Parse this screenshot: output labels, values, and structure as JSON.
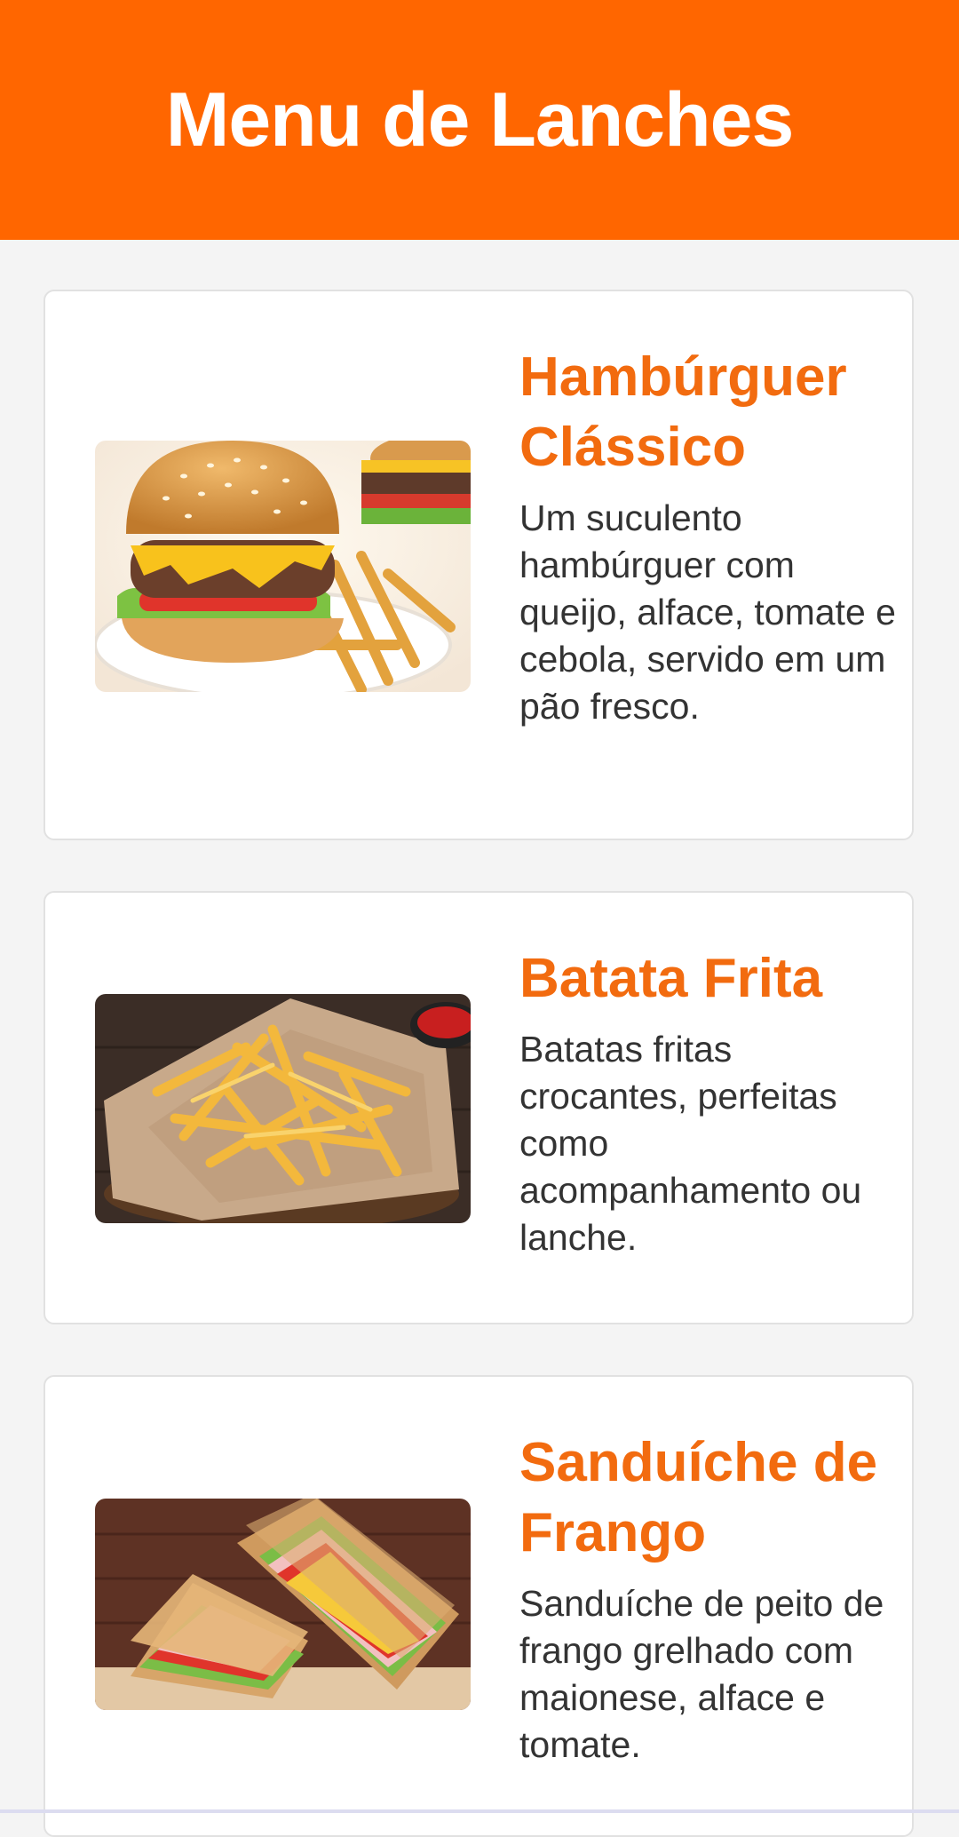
{
  "header": {
    "title": "Menu de Lanches"
  },
  "menu": [
    {
      "title": "Hambúrguer Clássico",
      "description": "Um suculento hambúrguer com queijo, alface, tomate e cebola, servido em um pão fresco.",
      "image_icon": "burger-photo"
    },
    {
      "title": "Batata Frita",
      "description": "Batatas fritas crocantes, perfeitas como acompanhamento ou lanche.",
      "image_icon": "fries-photo"
    },
    {
      "title": "Sanduíche de Frango",
      "description": "Sanduíche de peito de frango grelhado com maionese, alface e tomate.",
      "image_icon": "sandwich-photo"
    }
  ],
  "colors": {
    "header_bg": "#ff6600",
    "title": "#f26b0f",
    "text": "#333333",
    "page_bg": "#f4f4f4"
  }
}
